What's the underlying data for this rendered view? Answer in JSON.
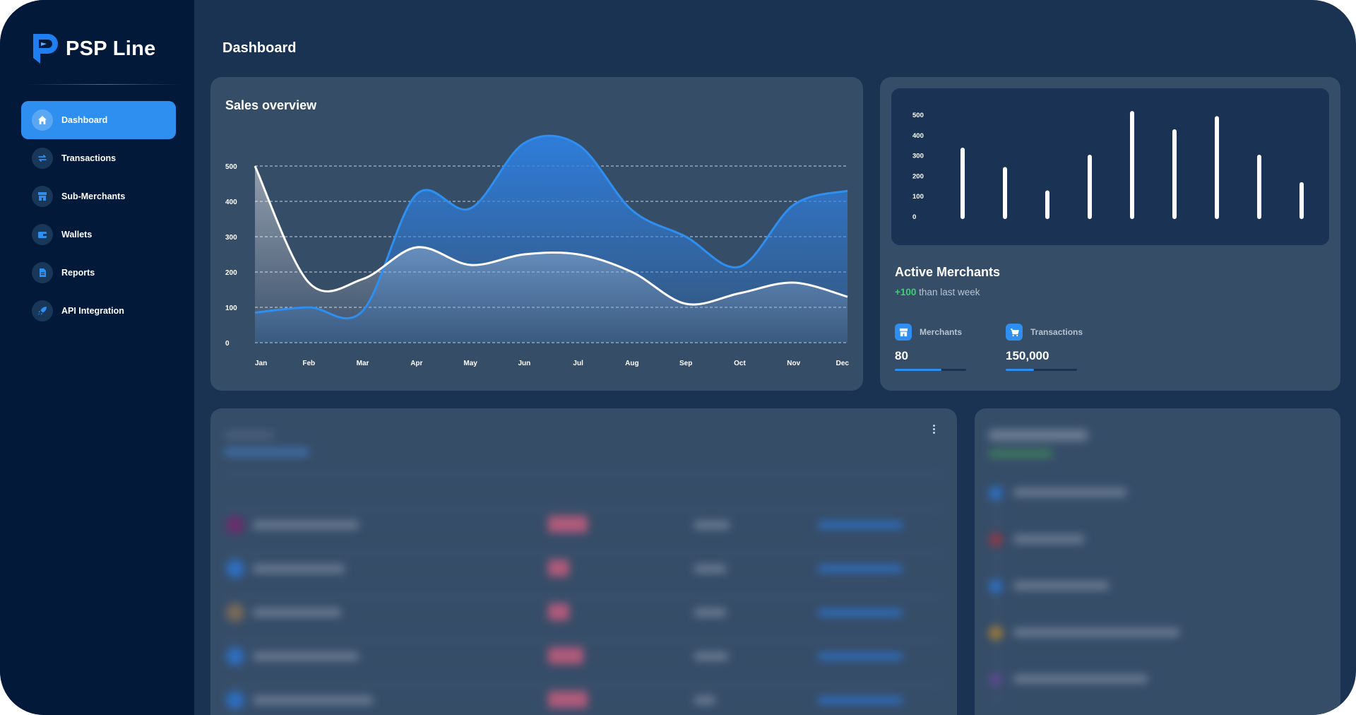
{
  "brand": {
    "name": "PSP Line"
  },
  "sidebar": {
    "items": [
      {
        "label": "Dashboard",
        "icon": "home-icon",
        "active": true
      },
      {
        "label": "Transactions",
        "icon": "swap-icon",
        "active": false
      },
      {
        "label": "Sub-Merchants",
        "icon": "store-icon",
        "active": false
      },
      {
        "label": "Wallets",
        "icon": "wallet-icon",
        "active": false
      },
      {
        "label": "Reports",
        "icon": "document-icon",
        "active": false
      },
      {
        "label": "API Integration",
        "icon": "rocket-icon",
        "active": false
      }
    ]
  },
  "header": {
    "title": "Dashboard"
  },
  "sales": {
    "title": "Sales overview",
    "chart_data": {
      "type": "area",
      "categories": [
        "Jan",
        "Feb",
        "Mar",
        "Apr",
        "May",
        "Jun",
        "Jul",
        "Aug",
        "Sep",
        "Oct",
        "Nov",
        "Dec"
      ],
      "y_ticks": [
        "0",
        "100",
        "200",
        "300",
        "400",
        "500"
      ],
      "ylim": [
        0,
        500
      ],
      "grid": true,
      "series": [
        {
          "color": "#2e8ff0",
          "values": [
            85,
            100,
            90,
            420,
            380,
            565,
            560,
            375,
            300,
            215,
            390,
            430
          ]
        },
        {
          "color": "#ffffff",
          "values": [
            500,
            170,
            180,
            270,
            220,
            250,
            250,
            200,
            110,
            140,
            170,
            130
          ]
        }
      ]
    }
  },
  "merchants": {
    "title": "Active Merchants",
    "delta": "+100",
    "delta_suffix": " than last week",
    "chart_data": {
      "type": "bar",
      "y_ticks": [
        "0",
        "100",
        "200",
        "300",
        "400",
        "500"
      ],
      "ylim": [
        0,
        500
      ],
      "values": [
        330,
        235,
        120,
        295,
        510,
        420,
        485,
        295,
        160
      ]
    },
    "stats": [
      {
        "label": "Merchants",
        "value": "80",
        "icon": "store-icon",
        "progress": 0.65
      },
      {
        "label": "Transactions",
        "value": "150,000",
        "icon": "cart-icon",
        "progress": 0.4
      }
    ]
  }
}
